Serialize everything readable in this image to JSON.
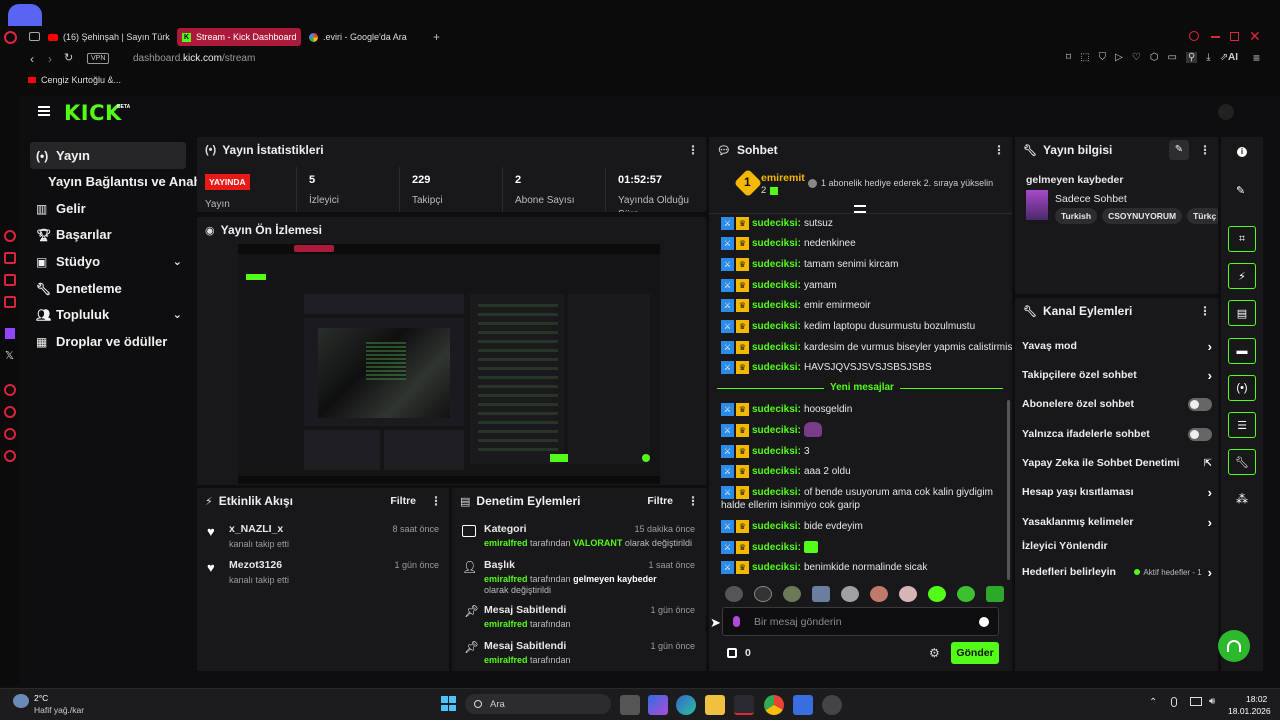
{
  "browser": {
    "tabs": [
      {
        "label": "(16) Şehinşah | Sayın Türk"
      },
      {
        "label": "Stream - Kick Dashboard"
      },
      {
        "label": ".eviri - Google'da Ara"
      }
    ],
    "vpn": "VPN",
    "url_prefix": "dashboard.",
    "url_domain": "kick.com",
    "url_path": "/stream",
    "bookmark": "Cengiz Kurtoğlu &...",
    "ai_label": "AI"
  },
  "app": {
    "logo": "KICK",
    "logo_badge": "BETA"
  },
  "sidebar": {
    "items": [
      {
        "label": "Yayın",
        "icon": "broadcast-icon"
      },
      {
        "label": "Yayın Bağlantısı ve Anahtarı"
      },
      {
        "label": "Gelir",
        "icon": "chart-icon"
      },
      {
        "label": "Başarılar",
        "icon": "trophy-icon"
      },
      {
        "label": "Stüdyo",
        "icon": "video-icon"
      },
      {
        "label": "Denetleme",
        "icon": "wrench-icon"
      },
      {
        "label": "Topluluk",
        "icon": "users-icon"
      },
      {
        "label": "Droplar ve ödüller",
        "icon": "grid-icon"
      }
    ]
  },
  "stats": {
    "title": "Yayın İstatistikleri",
    "live_badge": "YAYINDA",
    "status_label": "Yayın",
    "viewers_value": "5",
    "viewers_label": "İzleyici",
    "followers_value": "229",
    "followers_label": "Takipçi",
    "subs_value": "2",
    "subs_label": "Abone Sayısı",
    "uptime_value": "01:52:57",
    "uptime_label": "Yayında Olduğu Süre"
  },
  "preview": {
    "title": "Yayın Ön İzlemesi"
  },
  "activity": {
    "title": "Etkinlik Akışı",
    "filter": "Filtre",
    "items": [
      {
        "name": "x_NAZLI_x",
        "sub": "kanalı takip etti",
        "time": "8 saat önce"
      },
      {
        "name": "Mezot3126",
        "sub": "kanalı takip etti",
        "time": "1 gün önce"
      }
    ]
  },
  "moderation": {
    "title": "Denetim Eylemleri",
    "filter": "Filtre",
    "items": [
      {
        "title": "Kategori",
        "time": "15 dakika önce",
        "actor": "emiralfred",
        "mid": " tarafından ",
        "value": "VALORANT",
        "end": " olarak değiştirildi"
      },
      {
        "title": "Başlık",
        "time": "1 saat önce",
        "actor": "emiralfred",
        "mid": " tarafından ",
        "value": "gelmeyen kaybeder",
        "end": " olarak değiştirildi"
      },
      {
        "title": "Mesaj Sabitlendi",
        "time": "1 gün önce",
        "actor": "emiralfred",
        "mid": " tarafından",
        "value": "",
        "end": ""
      },
      {
        "title": "Mesaj Sabitlendi",
        "time": "1 gün önce",
        "actor": "emiralfred",
        "mid": " tarafından",
        "value": "",
        "end": ""
      }
    ]
  },
  "chat": {
    "title": "Sohbet",
    "gift_user": "emiremit",
    "gift_count": "2",
    "gift_rank": "1",
    "gift_text": "1 abonelik hediye ederek 2. sıraya yükselin",
    "new_messages": "Yeni mesajlar",
    "messages_before": [
      {
        "user": "sudeciksi",
        "text": "sutsuz"
      },
      {
        "user": "sudeciksi",
        "text": "nedenkinee"
      },
      {
        "user": "sudeciksi",
        "text": "tamam senimi kircam"
      },
      {
        "user": "sudeciksi",
        "text": "yamam"
      },
      {
        "user": "sudeciksi",
        "text": "emir emirmeoir"
      },
      {
        "user": "sudeciksi",
        "text": "kedim laptopu dusurmustu bozulmustu"
      },
      {
        "user": "sudeciksi",
        "text": "kardesim de vurmus biseyler yapmis calistirmis"
      },
      {
        "user": "sudeciksi",
        "text": "HAVSJQVSJSVSJSBSJSBS"
      }
    ],
    "messages_after": [
      {
        "user": "sudeciksi",
        "text": "hoosgeldin"
      },
      {
        "user": "sudeciksi",
        "text": ""
      },
      {
        "user": "sudeciksi",
        "text": "3"
      },
      {
        "user": "sudeciksi",
        "text": "aaa 2 oldu"
      },
      {
        "user": "sudeciksi",
        "text": "of bende usuyorum ama cok kalin giydigim halde ellerim isinmiyo cok garip"
      },
      {
        "user": "sudeciksi",
        "text": "bide evdeyim"
      },
      {
        "user": "sudeciksi",
        "text": ""
      },
      {
        "user": "sudeciksi",
        "text": "benimkide normalinde sicak"
      }
    ],
    "input_placeholder": "Bir mesaj gönderin",
    "points": "0",
    "send": "Gönder"
  },
  "info": {
    "title": "Yayın bilgisi",
    "stream_title": "gelmeyen kaybeder",
    "category": "Sadece Sohbet",
    "tags": [
      "Turkish",
      "CSOYNUYORUM",
      "Türkç"
    ]
  },
  "channel_actions": {
    "title": "Kanal Eylemleri",
    "items": [
      {
        "label": "Yavaş mod",
        "control": "chevron"
      },
      {
        "label": "Takipçilere özel sohbet",
        "control": "chevron"
      },
      {
        "label": "Abonelere özel sohbet",
        "control": "toggle"
      },
      {
        "label": "Yalnızca ifadelerle sohbet",
        "control": "toggle"
      },
      {
        "label": "Yapay Zeka ile Sohbet Denetimi",
        "control": "external"
      },
      {
        "label": "Hesap yaşı kısıtlaması",
        "control": "chevron"
      },
      {
        "label": "Yasaklanmış kelimeler",
        "control": "chevron"
      },
      {
        "label": "İzleyici Yönlendir",
        "control": "none"
      },
      {
        "label": "Hedefleri belirleyin",
        "control": "chevron"
      }
    ],
    "goals_status": "Aktif hedefler - 1"
  },
  "taskbar": {
    "temp": "2°C",
    "weather": "Hafif yağ./kar",
    "search": "Ara",
    "time": "18:02",
    "date": "18.01.2026"
  },
  "colors": {
    "accent": "#53fc18",
    "live": "#e91916",
    "bg": "#0e0e10",
    "panel": "#18181b"
  }
}
